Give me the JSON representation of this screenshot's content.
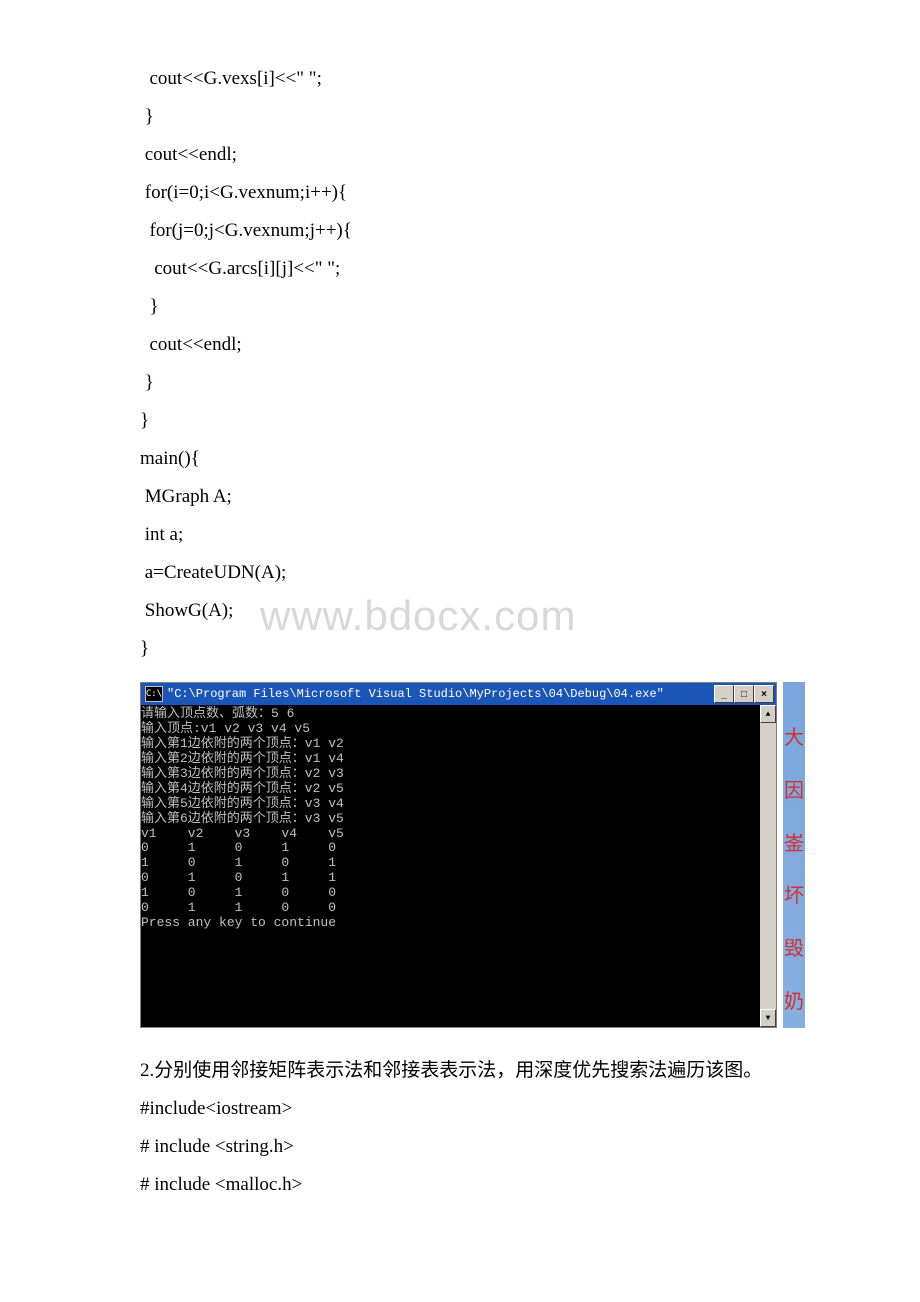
{
  "code": {
    "l1": "  cout<<G.vexs[i]<<\" \";",
    "l2": " }",
    "l3": " cout<<endl;",
    "l4": " for(i=0;i<G.vexnum;i++){",
    "l5": "  for(j=0;j<G.vexnum;j++){",
    "l6": "   cout<<G.arcs[i][j]<<\" \";",
    "l7": "  }",
    "l8": "  cout<<endl;",
    "l9": " }",
    "l10": "}",
    "l11": "main(){",
    "l12": " MGraph A;",
    "l13": " int a;",
    "l14": " a=CreateUDN(A);",
    "l15": " ShowG(A);",
    "l16": "}"
  },
  "watermark": "www.bdocx.com",
  "console": {
    "icon": "C:\\",
    "title": "\"C:\\Program Files\\Microsoft Visual Studio\\MyProjects\\04\\Debug\\04.exe\"",
    "buttons": {
      "min": "_",
      "max": "□",
      "close": "×"
    },
    "scroll": {
      "up": "▲",
      "down": "▼"
    },
    "output": "请输入顶点数、弧数：5 6\n输入顶点:v1 v2 v3 v4 v5\n输入第1边依附的两个顶点：v1 v2\n输入第2边依附的两个顶点：v1 v4\n输入第3边依附的两个顶点：v2 v3\n输入第4边依附的两个顶点：v2 v5\n输入第5边依附的两个顶点：v3 v4\n输入第6边依附的两个顶点：v3 v5\nv1    v2    v3    v4    v5\n0     1     0     1     0\n1     0     1     0     1\n0     1     0     1     1\n1     0     1     0     0\n0     1     1     0     0\nPress any key to continue"
  },
  "side_chars": {
    "c1": "大",
    "c2": "因",
    "c3": "崟",
    "c4": "坏",
    "c5": "毁",
    "c6": "奶"
  },
  "after": {
    "p1": "2.分别使用邻接矩阵表示法和邻接表表示法，用深度优先搜索法遍历该图。",
    "p2": "#include<iostream>",
    "p3": "# include <string.h>",
    "p4": "# include <malloc.h>"
  }
}
